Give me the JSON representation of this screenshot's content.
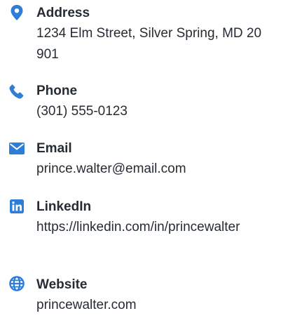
{
  "colors": {
    "icon": "#2e7dd7",
    "text": "#262c33"
  },
  "contacts": [
    {
      "icon": "map-pin-icon",
      "title": "Address",
      "value": "1234 Elm Street, Silver Spring, MD 20901"
    },
    {
      "icon": "phone-icon",
      "title": "Phone",
      "value": "(301) 555-0123"
    },
    {
      "icon": "envelope-icon",
      "title": "Email",
      "value": "prince.walter@email.com"
    },
    {
      "icon": "linkedin-icon",
      "title": "LinkedIn",
      "value": "https://linkedin.com/in/princewalter"
    },
    {
      "icon": "globe-icon",
      "title": "Website",
      "value": "princewalter.com"
    }
  ]
}
